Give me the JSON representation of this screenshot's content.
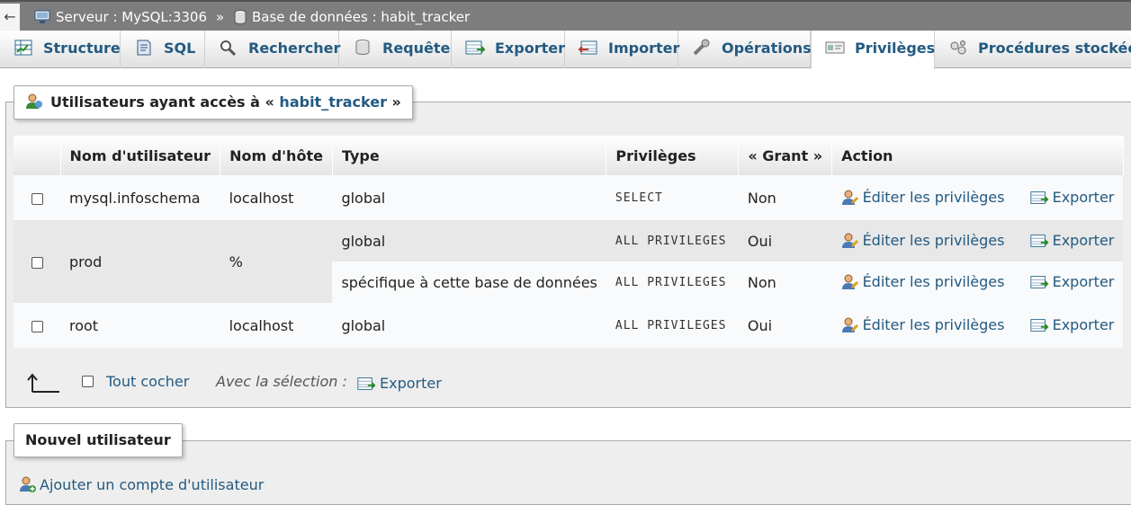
{
  "topbar": {
    "back_glyph": "←",
    "server": "Serveur : MySQL:3306",
    "separator": "»",
    "database": "Base de données : habit_tracker"
  },
  "tabs": [
    {
      "label": "Structure",
      "icon": "structure-icon"
    },
    {
      "label": "SQL",
      "icon": "sql-icon"
    },
    {
      "label": "Rechercher",
      "icon": "search-icon"
    },
    {
      "label": "Requête",
      "icon": "query-icon"
    },
    {
      "label": "Exporter",
      "icon": "export-icon"
    },
    {
      "label": "Importer",
      "icon": "import-icon"
    },
    {
      "label": "Opérations",
      "icon": "wrench-icon"
    },
    {
      "label": "Privilèges",
      "icon": "privileges-icon",
      "active": true
    },
    {
      "label": "Procédures stockées",
      "icon": "routines-icon"
    }
  ],
  "users_section": {
    "legend_prefix": "Utilisateurs ayant accès à «",
    "legend_db": "habit_tracker",
    "legend_suffix": "»",
    "columns": [
      "",
      "Nom d'utilisateur",
      "Nom d'hôte",
      "Type",
      "Privilèges",
      "« Grant »",
      "Action"
    ],
    "rows": [
      {
        "user": "mysql.infoschema",
        "host": "localhost",
        "type": "global",
        "privileges": "SELECT",
        "grant": "Non"
      },
      {
        "user": "prod",
        "host": "%",
        "type": "global",
        "privileges": "ALL PRIVILEGES",
        "grant": "Oui"
      },
      {
        "user": "",
        "host": "",
        "type": "spécifique à cette base de données",
        "privileges": "ALL PRIVILEGES",
        "grant": "Non"
      },
      {
        "user": "root",
        "host": "localhost",
        "type": "global",
        "privileges": "ALL PRIVILEGES",
        "grant": "Oui"
      }
    ],
    "edit_label": "Éditer les privilèges",
    "export_label": "Exporter",
    "check_all_label": "Tout cocher",
    "with_selection_label": "Avec la sélection :",
    "bulk_export_label": "Exporter"
  },
  "new_user_section": {
    "legend": "Nouvel utilisateur",
    "add_label": "Ajouter un compte d'utilisateur"
  },
  "colors": {
    "link": "#235a81",
    "topbar": "#7d7d7d",
    "panel": "#eeeeee"
  }
}
